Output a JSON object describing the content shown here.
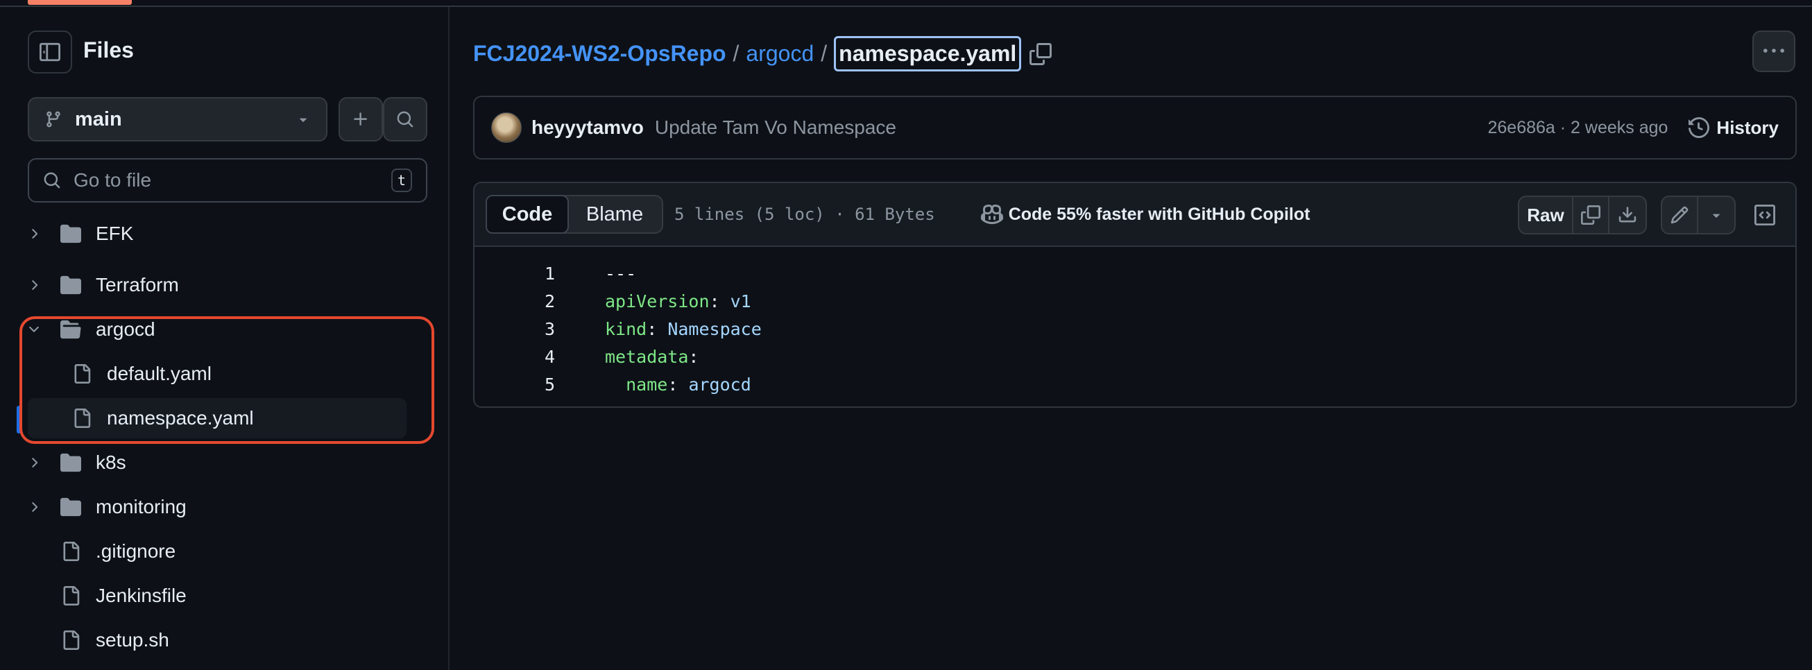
{
  "sidebar": {
    "title": "Files",
    "branch": "main",
    "goto_placeholder": "Go to file",
    "goto_shortcut": "t",
    "tree": [
      {
        "name": "EFK",
        "type": "folder",
        "expanded": false
      },
      {
        "name": "Terraform",
        "type": "folder",
        "expanded": false
      },
      {
        "name": "argocd",
        "type": "folder",
        "expanded": true
      },
      {
        "name": "default.yaml",
        "type": "file"
      },
      {
        "name": "namespace.yaml",
        "type": "file",
        "selected": true
      },
      {
        "name": "k8s",
        "type": "folder",
        "expanded": false
      },
      {
        "name": "monitoring",
        "type": "folder",
        "expanded": false
      },
      {
        "name": ".gitignore",
        "type": "file"
      },
      {
        "name": "Jenkinsfile",
        "type": "file"
      },
      {
        "name": "setup.sh",
        "type": "file"
      }
    ]
  },
  "breadcrumb": {
    "repo": "FCJ2024-WS2-OpsRepo",
    "sep1": "/",
    "dir": "argocd",
    "sep2": "/",
    "file": "namespace.yaml"
  },
  "commit": {
    "author": "heyyytamvo",
    "message": "Update Tam Vo Namespace",
    "meta": "26e686a · 2 weeks ago",
    "history_label": "History"
  },
  "file_view": {
    "tab_code": "Code",
    "tab_blame": "Blame",
    "info": "5 lines (5 loc) · 61 Bytes",
    "copilot": "Code 55% faster with GitHub Copilot",
    "raw_label": "Raw",
    "lines": [
      {
        "n": "1",
        "key": "",
        "colon": "",
        "value": "---",
        "indent": ""
      },
      {
        "n": "2",
        "key": "apiVersion",
        "colon": ": ",
        "value": "v1",
        "indent": ""
      },
      {
        "n": "3",
        "key": "kind",
        "colon": ": ",
        "value": "Namespace",
        "indent": ""
      },
      {
        "n": "4",
        "key": "metadata",
        "colon": ":",
        "value": "",
        "indent": ""
      },
      {
        "n": "5",
        "key": "name",
        "colon": ": ",
        "value": "argocd",
        "indent": "  "
      }
    ]
  },
  "colors": {
    "background": "#0d1117",
    "link": "#4493f8",
    "highlight_outline": "#e5482f",
    "yaml_key": "#7ee787",
    "yaml_value": "#a5d6ff"
  }
}
